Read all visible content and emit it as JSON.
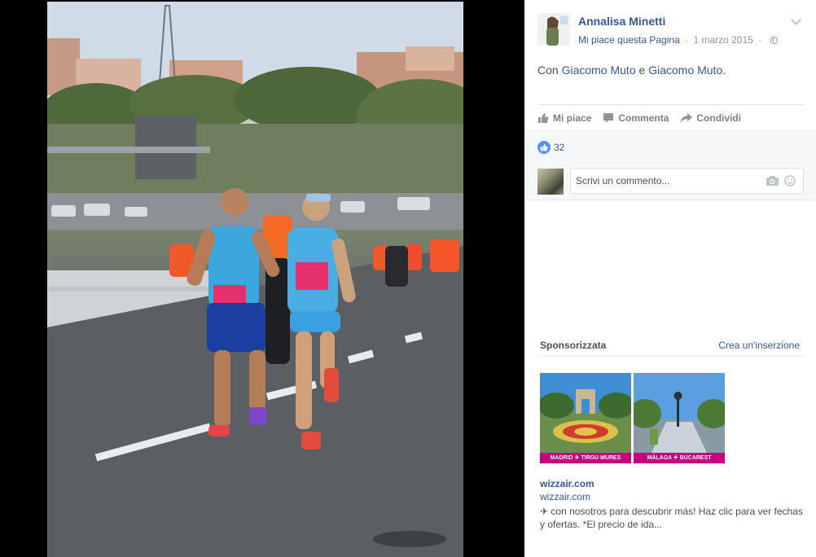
{
  "post": {
    "author": "Annalisa Minetti",
    "like_page": "Mi piace questa Pagina",
    "separator": "·",
    "date": "1 marzo 2015",
    "text_prefix": "Con ",
    "tag1": "Giacomo Muto",
    "conjunction": " e ",
    "tag2": "Giacomo Muto",
    "text_suffix": ".",
    "photo_icon": "running-race-photo"
  },
  "actions": {
    "like": "Mi piace",
    "comment": "Commenta",
    "share": "Condividi"
  },
  "reactions": {
    "likes_count": "32"
  },
  "comment_box": {
    "placeholder": "Scrivi un commento..."
  },
  "sponsored": {
    "title": "Sponsorizzata",
    "create_ad": "Crea un'inserzione",
    "ad1_caption": "MADRID ✈ TIRGU MURES",
    "ad2_caption": "MÁLAGA ✈ BUCAREST",
    "advertiser": "wizzair.com",
    "domain": "wizzair.com",
    "text": "✈ con nosotros para descubrir más! Haz clic para ver fechas y ofertas. *El precio de ida..."
  },
  "colors": {
    "link": "#365899",
    "text": "#4b4f56",
    "muted": "#90949c",
    "like_badge": "#5890ff",
    "wizz_magenta": "#c6007e"
  }
}
